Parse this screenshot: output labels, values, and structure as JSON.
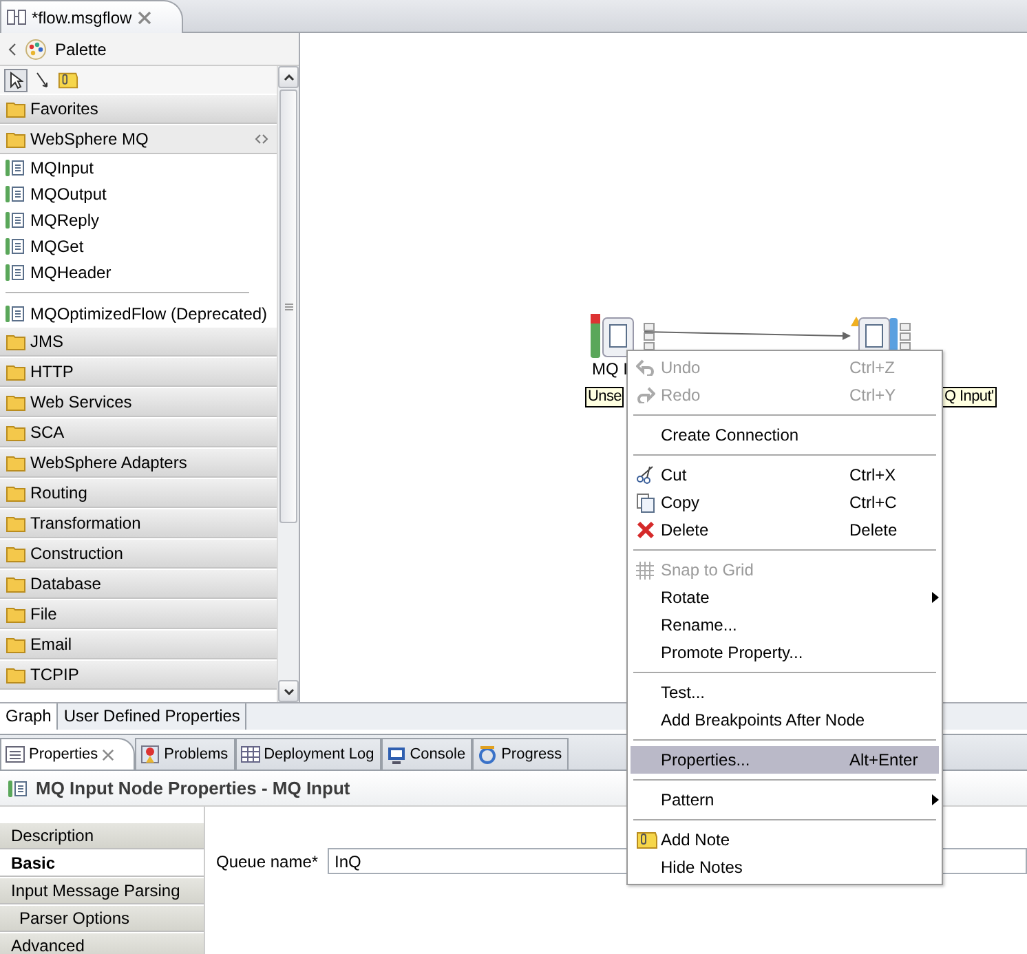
{
  "editor_tabs": [
    {
      "label": "*flow.msgflow",
      "selected": true
    }
  ],
  "palette": {
    "title": "Palette",
    "drawers": [
      {
        "label": "Favorites",
        "expanded": false
      },
      {
        "label": "WebSphere MQ",
        "expanded": true,
        "items": [
          {
            "label": "MQInput",
            "kind": "node"
          },
          {
            "label": "MQOutput",
            "kind": "node"
          },
          {
            "label": "MQReply",
            "kind": "node"
          },
          {
            "label": "MQGet",
            "kind": "node"
          },
          {
            "label": "MQHeader",
            "kind": "node"
          },
          {
            "kind": "separator"
          },
          {
            "label": "MQOptimizedFlow (Deprecated)",
            "kind": "node"
          }
        ]
      },
      {
        "label": "JMS",
        "expanded": false
      },
      {
        "label": "HTTP",
        "expanded": false
      },
      {
        "label": "Web Services",
        "expanded": false
      },
      {
        "label": "SCA",
        "expanded": false
      },
      {
        "label": "WebSphere Adapters",
        "expanded": false
      },
      {
        "label": "Routing",
        "expanded": false
      },
      {
        "label": "Transformation",
        "expanded": false
      },
      {
        "label": "Construction",
        "expanded": false
      },
      {
        "label": "Database",
        "expanded": false
      },
      {
        "label": "File",
        "expanded": false
      },
      {
        "label": "Email",
        "expanded": false
      },
      {
        "label": "TCPIP",
        "expanded": false
      }
    ]
  },
  "canvas": {
    "nodes": [
      {
        "label": "MQ I",
        "tooltip": "Unse",
        "kind": "input"
      },
      {
        "tooltip": "Q Input'",
        "kind": "output"
      }
    ]
  },
  "context_menu": [
    [
      {
        "label": "Undo",
        "shortcut": "Ctrl+Z",
        "kind": "undo",
        "disabled": true,
        "selected": false
      },
      {
        "label": "Redo",
        "shortcut": "Ctrl+Y",
        "kind": "redo",
        "disabled": true,
        "selected": false
      }
    ],
    [
      {
        "label": "Create Connection",
        "disabled": false,
        "selected": false
      }
    ],
    [
      {
        "label": "Cut",
        "shortcut": "Ctrl+X",
        "kind": "cut",
        "disabled": false,
        "selected": false
      },
      {
        "label": "Copy",
        "shortcut": "Ctrl+C",
        "kind": "copy",
        "disabled": false,
        "selected": false
      },
      {
        "label": "Delete",
        "shortcut": "Delete",
        "kind": "delete",
        "disabled": false,
        "selected": false
      }
    ],
    [
      {
        "label": "Snap to Grid",
        "kind": "grid",
        "disabled": true,
        "selected": false
      },
      {
        "label": "Rotate",
        "submenu": true,
        "disabled": false,
        "selected": false
      },
      {
        "label": "Rename...",
        "disabled": false,
        "selected": false
      },
      {
        "label": "Promote Property...",
        "disabled": false,
        "selected": false
      }
    ],
    [
      {
        "label": "Test...",
        "disabled": false,
        "selected": false
      },
      {
        "label": "Add Breakpoints After Node",
        "disabled": false,
        "selected": false
      }
    ],
    [
      {
        "label": "Properties...",
        "shortcut": "Alt+Enter",
        "disabled": false,
        "selected": true
      }
    ],
    [
      {
        "label": "Pattern",
        "submenu": true,
        "disabled": false,
        "selected": false
      }
    ],
    [
      {
        "label": "Add Note",
        "kind": "note",
        "disabled": false,
        "selected": false
      },
      {
        "label": "Hide Notes",
        "disabled": false,
        "selected": false
      }
    ]
  ],
  "editor_bottom_tabs": [
    {
      "label": "Graph",
      "selected": true
    },
    {
      "label": "User Defined Properties",
      "selected": false
    }
  ],
  "view_tabs": [
    {
      "label": "Properties",
      "selected": true,
      "closable": true,
      "kind": "properties"
    },
    {
      "label": "Problems",
      "selected": false,
      "kind": "problems"
    },
    {
      "label": "Deployment Log",
      "selected": false,
      "kind": "table"
    },
    {
      "label": "Console",
      "selected": false,
      "kind": "console"
    },
    {
      "label": "Progress",
      "selected": false,
      "kind": "progress"
    }
  ],
  "properties": {
    "title": "MQ Input Node Properties - MQ Input",
    "sections": [
      {
        "label": "Description",
        "selected": false
      },
      {
        "label": "Basic",
        "selected": true
      },
      {
        "label": "Input Message Parsing",
        "selected": false,
        "children": [
          {
            "label": "Parser Options",
            "selected": false
          }
        ]
      },
      {
        "label": "Advanced",
        "selected": false
      }
    ],
    "fields": [
      {
        "label": "Queue name*",
        "value": "InQ"
      }
    ]
  }
}
